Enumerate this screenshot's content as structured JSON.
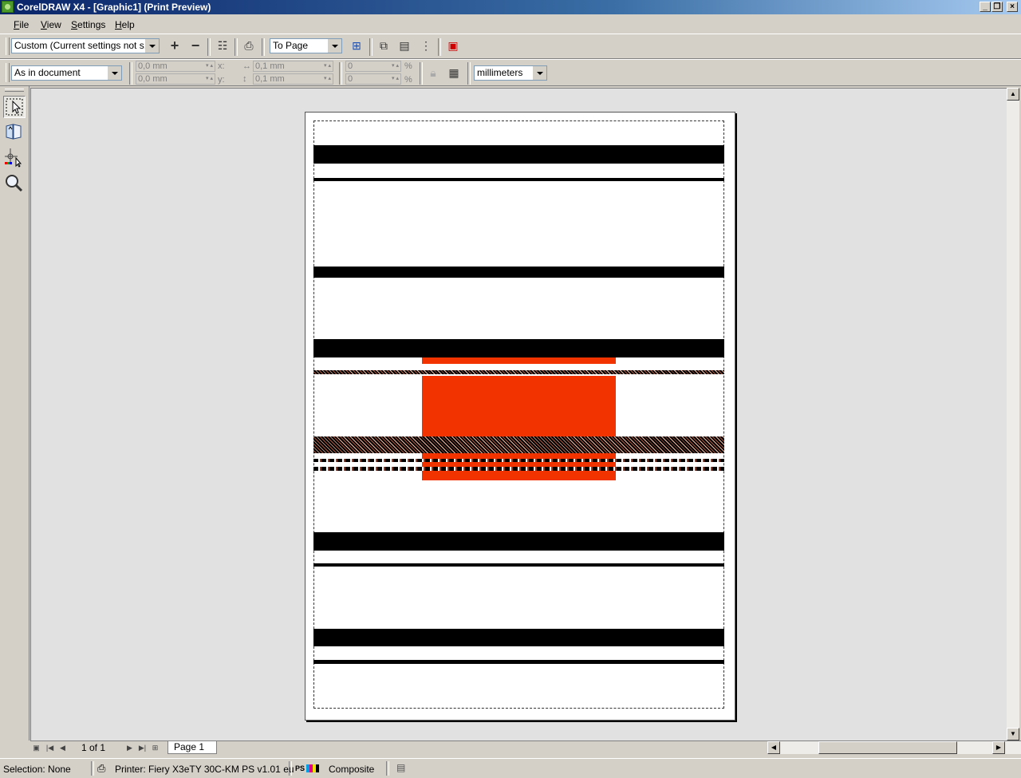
{
  "window": {
    "title": "CorelDRAW X4 - [Graphic1] (Print Preview)"
  },
  "menu": [
    {
      "label": "File",
      "key": "F",
      "rest": "ile"
    },
    {
      "label": "View",
      "key": "V",
      "rest": "iew"
    },
    {
      "label": "Settings",
      "key": "S",
      "rest": "ettings"
    },
    {
      "label": "Help",
      "key": "H",
      "rest": "elp"
    }
  ],
  "toolbar1": {
    "print_style": "Custom (Current settings not s...",
    "zoom": "To Page"
  },
  "toolbar2": {
    "position": "As in document",
    "x_value": "0,0 mm",
    "y_value": "0,0 mm",
    "x_label": "x:",
    "y_label": "y:",
    "width_value": "0,1 mm",
    "height_value": "0,1 mm",
    "scale_x": "0",
    "scale_y": "0",
    "pct": "%",
    "units": "millimeters"
  },
  "pagebar": {
    "counter": "1 of 1",
    "page_tab": "Page 1"
  },
  "status": {
    "selection": "Selection: None",
    "printer": "Printer: Fiery X3eTY 30C-KM PS v1.01 eu",
    "mode": "Composite"
  },
  "colors": {
    "orange": "#f23300",
    "black": "#000000"
  }
}
